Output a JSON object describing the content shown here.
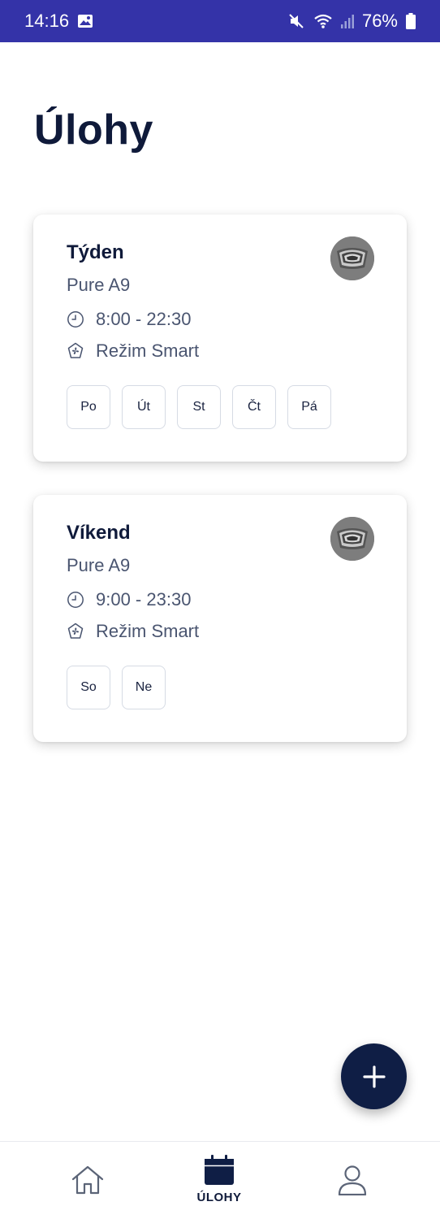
{
  "status_bar": {
    "time": "14:16",
    "battery": "76%"
  },
  "page": {
    "title": "Úlohy"
  },
  "tasks": [
    {
      "name": "Týden",
      "device": "Pure A9",
      "time": "8:00 - 22:30",
      "mode": "Režim Smart",
      "days": [
        "Po",
        "Út",
        "St",
        "Čt",
        "Pá"
      ]
    },
    {
      "name": "Víkend",
      "device": "Pure A9",
      "time": "9:00 - 23:30",
      "mode": "Režim Smart",
      "days": [
        "So",
        "Ne"
      ]
    }
  ],
  "fab": {
    "icon": "plus-icon"
  },
  "bottom_nav": {
    "items": [
      {
        "icon": "home-icon",
        "label": ""
      },
      {
        "icon": "calendar-icon",
        "label": "ÚLOHY",
        "active": true
      },
      {
        "icon": "profile-icon",
        "label": ""
      }
    ]
  },
  "colors": {
    "status_bar": "#3433a8",
    "primary_dark": "#0f1e45",
    "text_secondary": "#4a5570"
  }
}
